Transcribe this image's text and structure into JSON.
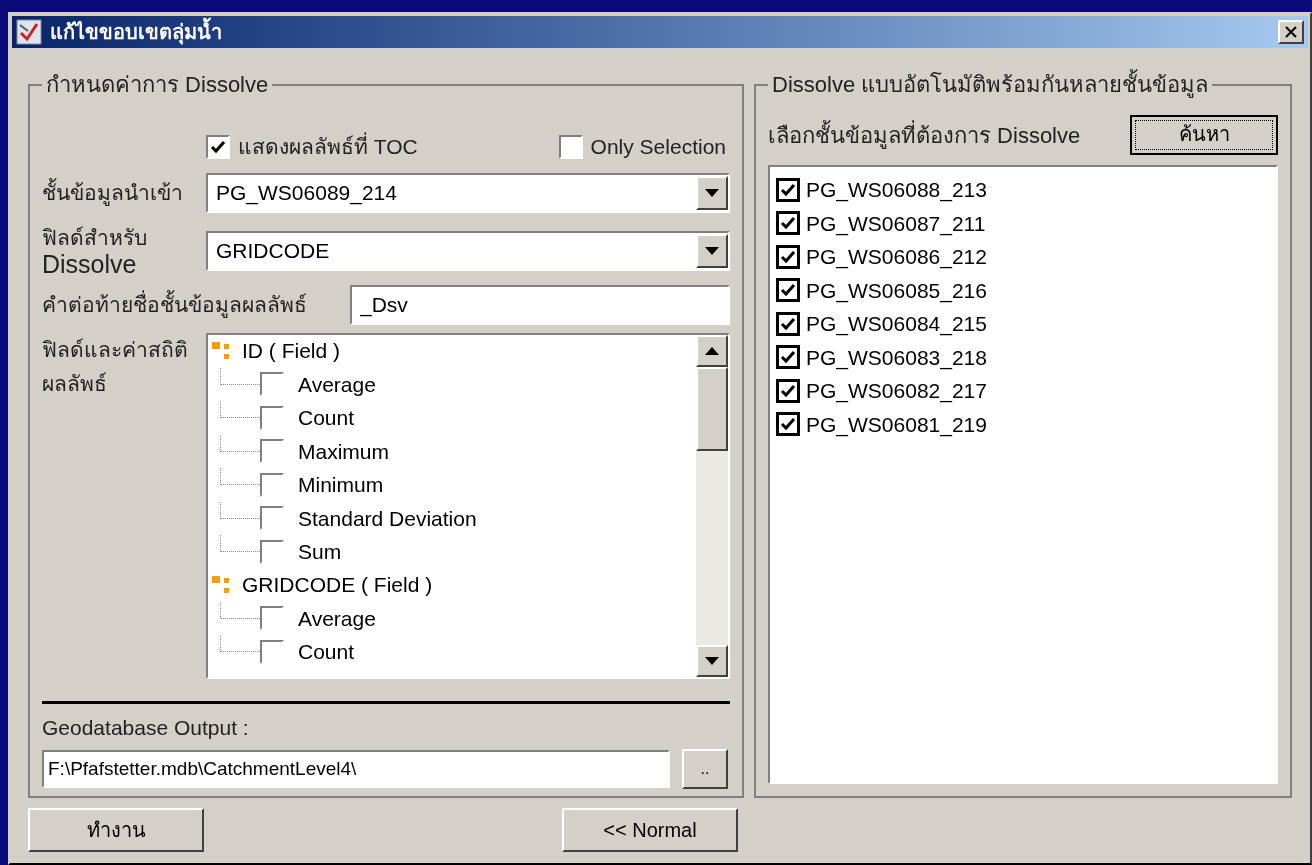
{
  "window": {
    "title": "แก้ไขขอบเขตลุ่มน้ำ"
  },
  "settings": {
    "legend": "กำหนดค่าการ Dissolve",
    "show_toc": {
      "label": "แสดงผลลัพธ์ที่ TOC",
      "checked": true
    },
    "only_selection": {
      "label": "Only Selection",
      "checked": false
    },
    "input_layer": {
      "label": "ชั้นข้อมูลนำเข้า",
      "value": "PG_WS06089_214"
    },
    "dissolve_field": {
      "label_lines": [
        "ฟิลด์สำหรับ",
        "Dissolve"
      ],
      "value": "GRIDCODE"
    },
    "suffix": {
      "label": "คำต่อท้ายชื่อชั้นข้อมูลผลลัพธ์",
      "value": "_Dsv"
    },
    "stats": {
      "label_lines": [
        "ฟิลด์และค่าสถิติ",
        "ผลลัพธ์"
      ],
      "tree": [
        {
          "label": "ID ( Field )",
          "children": [
            {
              "label": "Average",
              "checked": false
            },
            {
              "label": "Count",
              "checked": false
            },
            {
              "label": "Maximum",
              "checked": false
            },
            {
              "label": "Minimum",
              "checked": false
            },
            {
              "label": "Standard Deviation",
              "checked": false
            },
            {
              "label": "Sum",
              "checked": false
            }
          ]
        },
        {
          "label": "GRIDCODE ( Field )",
          "children": [
            {
              "label": "Average",
              "checked": false
            },
            {
              "label": "Count",
              "checked": false
            }
          ]
        }
      ]
    },
    "output": {
      "label": "Geodatabase Output :",
      "value": "F:\\Pfafstetter.mdb\\CatchmentLevel4\\",
      "browse": ".."
    }
  },
  "batch": {
    "legend": "Dissolve แบบอัตโนมัติพร้อมกันหลายชั้นข้อมูล",
    "prompt": "เลือกชั้นข้อมูลที่ต้องการ Dissolve",
    "search_button": "ค้นหา",
    "layers": [
      {
        "label": "PG_WS06088_213",
        "checked": true
      },
      {
        "label": "PG_WS06087_211",
        "checked": true
      },
      {
        "label": "PG_WS06086_212",
        "checked": true
      },
      {
        "label": "PG_WS06085_216",
        "checked": true
      },
      {
        "label": "PG_WS06084_215",
        "checked": true
      },
      {
        "label": "PG_WS06083_218",
        "checked": true
      },
      {
        "label": "PG_WS06082_217",
        "checked": true
      },
      {
        "label": "PG_WS06081_219",
        "checked": true
      }
    ]
  },
  "buttons": {
    "run": "ทำงาน",
    "normal": "<< Normal"
  }
}
